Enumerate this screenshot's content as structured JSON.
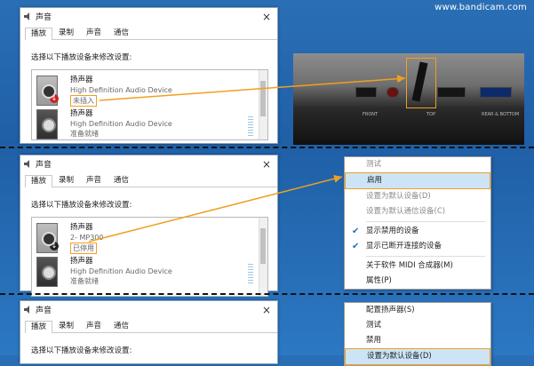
{
  "watermark": "www.bandicam.com",
  "dialogs": [
    {
      "title": "声音",
      "close": "×",
      "tabs": [
        "播放",
        "录制",
        "声音",
        "通信"
      ],
      "prompt": "选择以下播放设备来修改设置:",
      "devices": [
        {
          "name": "扬声器",
          "sub": "High Definition Audio Device",
          "state": "未插入"
        },
        {
          "name": "扬声器",
          "sub": "High Definition Audio Device",
          "state": "准备就绪"
        }
      ]
    },
    {
      "title": "声音",
      "close": "×",
      "tabs": [
        "播放",
        "录制",
        "声音",
        "通信"
      ],
      "prompt": "选择以下播放设备来修改设置:",
      "devices": [
        {
          "name": "扬声器",
          "sub": "2- MP300",
          "state": "已停用"
        },
        {
          "name": "扬声器",
          "sub": "High Definition Audio Device",
          "state": "准备就绪"
        }
      ]
    },
    {
      "title": "声音",
      "close": "×",
      "tabs": [
        "播放",
        "录制",
        "声音",
        "通信"
      ],
      "prompt": "选择以下播放设备来修改设置:"
    }
  ],
  "photo": {
    "labels": [
      "FRONT",
      "TOP",
      "REAR & BOTTOM"
    ]
  },
  "menu1": {
    "items": [
      {
        "label": "测试",
        "state": "disabled"
      },
      {
        "label": "启用",
        "state": "highlighted"
      },
      {
        "label": "设置为默认设备(D)",
        "state": "disabled"
      },
      {
        "label": "设置为默认通信设备(C)",
        "state": "disabled"
      },
      {
        "label": "显示禁用的设备",
        "checked": true
      },
      {
        "label": "显示已断开连接的设备",
        "checked": true
      },
      {
        "label": "关于软件 MIDI 合成器(M)"
      },
      {
        "label": "属性(P)"
      }
    ]
  },
  "menu2": {
    "items": [
      {
        "label": "配置扬声器(S)"
      },
      {
        "label": "测试"
      },
      {
        "label": "禁用"
      },
      {
        "label": "设置为默认设备(D)",
        "state": "highlighted"
      }
    ]
  },
  "colors": {
    "accent": "#f0a020",
    "desktop": "#2a6fb6",
    "highlight": "#cde4f7"
  }
}
